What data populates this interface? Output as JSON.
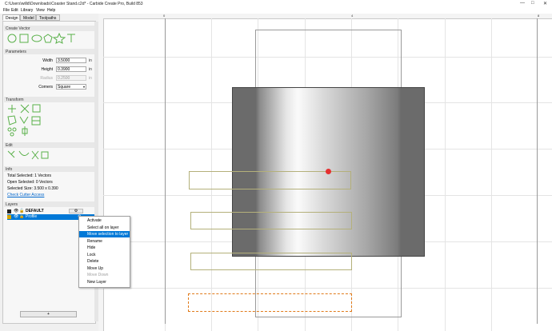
{
  "window": {
    "title": "C:\\Users\\willd\\Downloads\\Coaster Stand.c2d* - Carbide Create Pro, Build 853",
    "minimize": "—",
    "maximize": "□",
    "close": "✕"
  },
  "menu": [
    "File",
    "Edit",
    "Library",
    "View",
    "Help"
  ],
  "tabs": [
    "Design",
    "Model",
    "Toolpaths"
  ],
  "sections": {
    "create_vector": "Create Vector",
    "parameters": "Parameters",
    "transform": "Transform",
    "edit": "Edit",
    "info": "Info",
    "layers": "Layers"
  },
  "parameters": {
    "width_label": "Width",
    "width_value": "3.5000",
    "height_label": "Height",
    "height_value": "0.3900",
    "radius_label": "Radius",
    "radius_value": "0.2500",
    "corners_label": "Corners",
    "corners_value": "Square",
    "unit": "in"
  },
  "info": {
    "total_selected": "Total Selected:   1 Vectors",
    "open_selected": "Open Selected:    0 Vectors",
    "selected_size": "Selected Size:    3.500 x 0.390",
    "check_cutter": "Check Cutter Access"
  },
  "layers": [
    {
      "name": "DEFAULT",
      "selected": false,
      "color": "#222222"
    },
    {
      "name": "Profile",
      "selected": true,
      "color": "#d7a500"
    }
  ],
  "layers_add": "+",
  "ruler": {
    "h": [
      "0",
      "4",
      "8"
    ]
  },
  "context_menu": [
    {
      "label": "Activate",
      "state": "normal"
    },
    {
      "label": "Select all on layer",
      "state": "normal"
    },
    {
      "label": "Move selection to layer",
      "state": "highlight"
    },
    {
      "label": "Rename",
      "state": "normal"
    },
    {
      "label": "Hide",
      "state": "normal"
    },
    {
      "label": "Lock",
      "state": "normal"
    },
    {
      "label": "Delete",
      "state": "normal"
    },
    {
      "label": "Move Up",
      "state": "normal"
    },
    {
      "label": "Move Down",
      "state": "disabled"
    },
    {
      "label": "New Layer",
      "state": "normal"
    }
  ],
  "colors": {
    "accent": "#0078d7",
    "vector_green": "#5ab04a",
    "selection_orange": "#e07a1a",
    "olive_outline": "#b4b07a"
  }
}
